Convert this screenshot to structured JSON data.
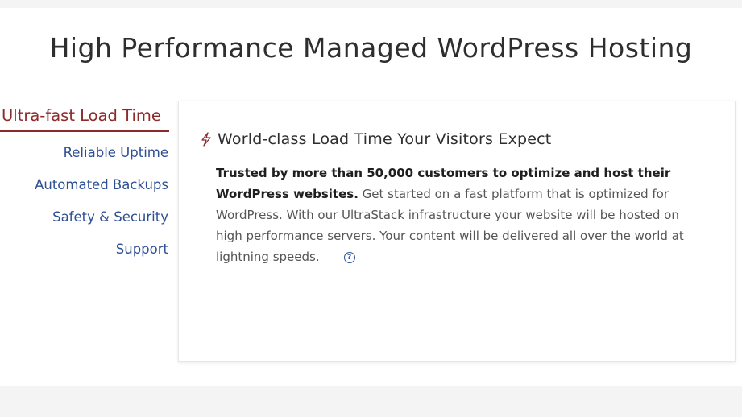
{
  "page": {
    "title": "High Performance Managed WordPress Hosting"
  },
  "tabs": [
    {
      "label": "Ultra-fast Load Time",
      "active": true
    },
    {
      "label": "Reliable Uptime",
      "active": false
    },
    {
      "label": "Automated Backups",
      "active": false
    },
    {
      "label": "Safety & Security",
      "active": false
    },
    {
      "label": "Support",
      "active": false
    }
  ],
  "panel": {
    "icon": "lightning-bolt-icon",
    "heading": "World-class Load Time Your Visitors Expect",
    "body_bold": "Trusted by more than 50,000 customers to optimize and host their WordPress websites.",
    "body_text": " Get started on a fast platform that is optimized for WordPress. With our UltraStack infrastructure your website will be hosted on high performance servers. Your content will be delivered all over the world at lightning speeds.",
    "help_icon": "help-circle-icon",
    "help_glyph": "?"
  },
  "colors": {
    "accent_active": "#8d2a2a",
    "link_blue": "#2d4f94",
    "page_background": "#f4f4f4"
  }
}
